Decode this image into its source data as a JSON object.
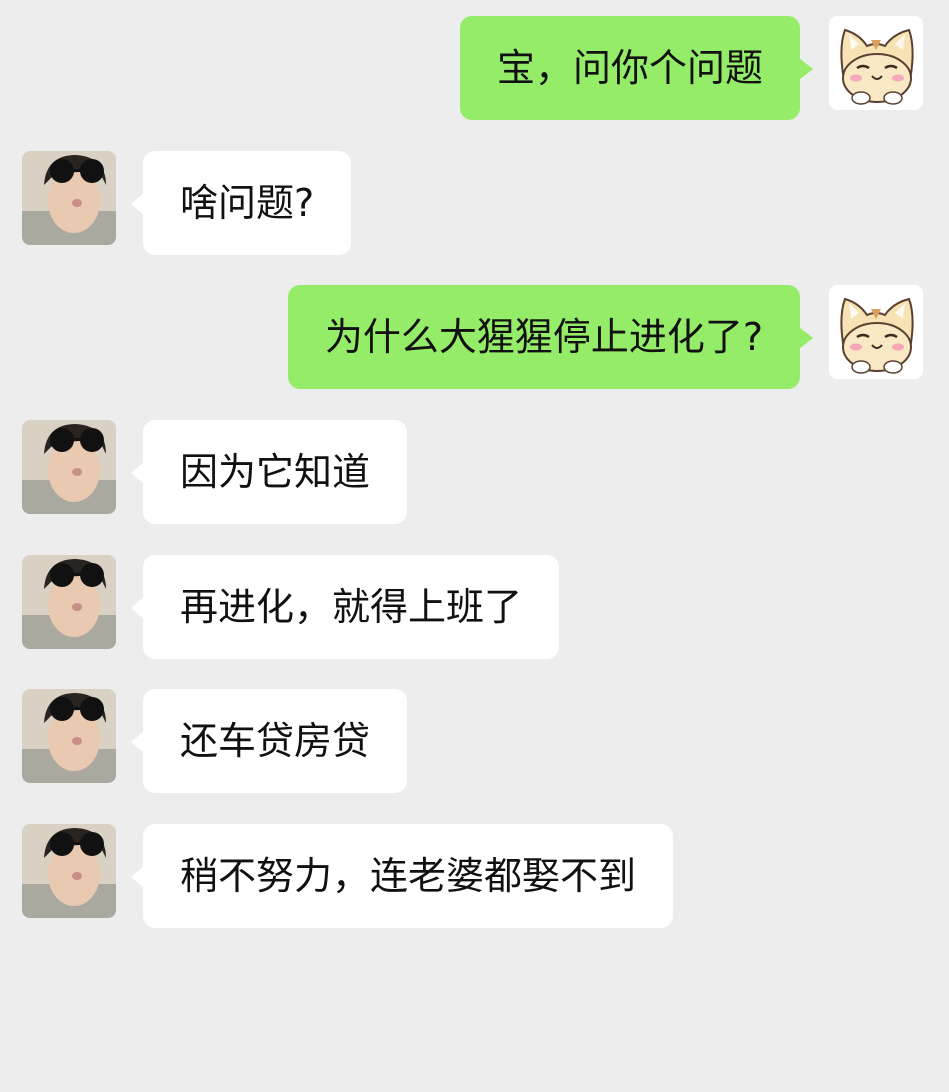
{
  "chat": {
    "messages": [
      {
        "from": "me",
        "text": "宝，问你个问题"
      },
      {
        "from": "friend",
        "text": "啥问题?"
      },
      {
        "from": "me",
        "text": "为什么大猩猩停止进化了?"
      },
      {
        "from": "friend",
        "text": "因为它知道"
      },
      {
        "from": "friend",
        "text": "再进化，就得上班了"
      },
      {
        "from": "friend",
        "text": "还车贷房贷"
      },
      {
        "from": "friend",
        "text": "稍不努力，连老婆都娶不到"
      }
    ]
  },
  "avatars": {
    "me": "cat-avatar-icon",
    "friend": "sunglasses-person-avatar"
  },
  "colors": {
    "background": "#ededed",
    "outgoing_bubble": "#95ec69",
    "incoming_bubble": "#ffffff"
  }
}
